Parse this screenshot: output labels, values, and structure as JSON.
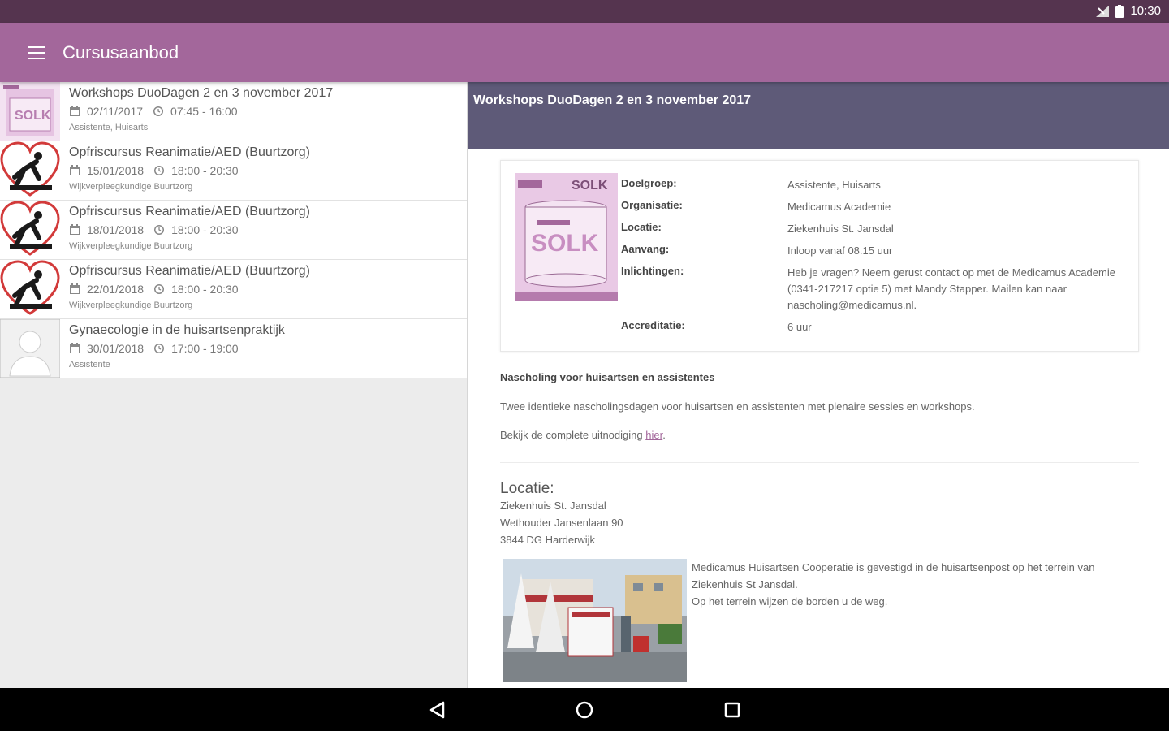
{
  "status_bar": {
    "time": "10:30",
    "icons": [
      "signal-icon",
      "battery-icon"
    ]
  },
  "app_bar": {
    "title": "Cursusaanbod",
    "menu_icon": "hamburger-menu-icon"
  },
  "colors": {
    "status_bar": "#55344f",
    "app_bar": "#a3679b",
    "detail_header": "#5e5a78",
    "nav_bar": "#000000"
  },
  "courses": [
    {
      "title": "Workshops DuoDagen 2 en 3 november 2017",
      "date": "02/11/2017",
      "time": "07:45 - 16:00",
      "audience": "Assistente, Huisarts",
      "thumb": "solk-poster"
    },
    {
      "title": "Opfriscursus Reanimatie/AED (Buurtzorg)",
      "date": "15/01/2018",
      "time": "18:00 - 20:30",
      "audience": "Wijkverpleegkundige Buurtzorg",
      "thumb": "cpr-heart-icon"
    },
    {
      "title": "Opfriscursus Reanimatie/AED (Buurtzorg)",
      "date": "18/01/2018",
      "time": "18:00 - 20:30",
      "audience": "Wijkverpleegkundige Buurtzorg",
      "thumb": "cpr-heart-icon"
    },
    {
      "title": "Opfriscursus Reanimatie/AED (Buurtzorg)",
      "date": "22/01/2018",
      "time": "18:00 - 20:30",
      "audience": "Wijkverpleegkundige Buurtzorg",
      "thumb": "cpr-heart-icon"
    },
    {
      "title": "Gynaecologie in de huisartsenpraktijk",
      "date": "30/01/2018",
      "time": "17:00 - 19:00",
      "audience": "Assistente",
      "thumb": "avatar-placeholder"
    }
  ],
  "detail": {
    "title": "Workshops DuoDagen 2 en 3 november 2017",
    "info": [
      {
        "label": "Doelgroep:",
        "value": "Assistente, Huisarts"
      },
      {
        "label": "Organisatie:",
        "value": "Medicamus Academie"
      },
      {
        "label": "Locatie:",
        "value": "Ziekenhuis St. Jansdal"
      },
      {
        "label": "Aanvang:",
        "value": "Inloop vanaf 08.15 uur"
      },
      {
        "label": "Inlichtingen:",
        "value": "Heb je vragen? Neem gerust contact op met de Medicamus Academie (0341-217217 optie 5) met Mandy Stapper. Mailen kan naar nascholing@medicamus.nl."
      },
      {
        "label": "Accreditatie:",
        "value": "6 uur"
      }
    ],
    "section_heading": "Nascholing voor huisartsen en assistentes",
    "section_text": "Twee identieke nascholingsdagen voor huisartsen en assistenten met plenaire sessies en workshops.",
    "invite_prefix": "Bekijk de complete uitnodiging ",
    "invite_link": "hier",
    "invite_suffix": ".",
    "location_heading": "Locatie:",
    "address": [
      "Ziekenhuis St. Jansdal",
      "Wethouder Jansenlaan 90",
      "3844 DG Harderwijk"
    ],
    "location_text_1": "Medicamus Huisartsen Coöperatie is gevestigd in de huisartsenpost op het terrein van Ziekenhuis St Jansdal.",
    "location_text_2": "Op het terrein wijzen de borden u de weg."
  },
  "nav_bar": {
    "buttons": [
      "back-icon",
      "home-icon",
      "recents-icon"
    ]
  }
}
